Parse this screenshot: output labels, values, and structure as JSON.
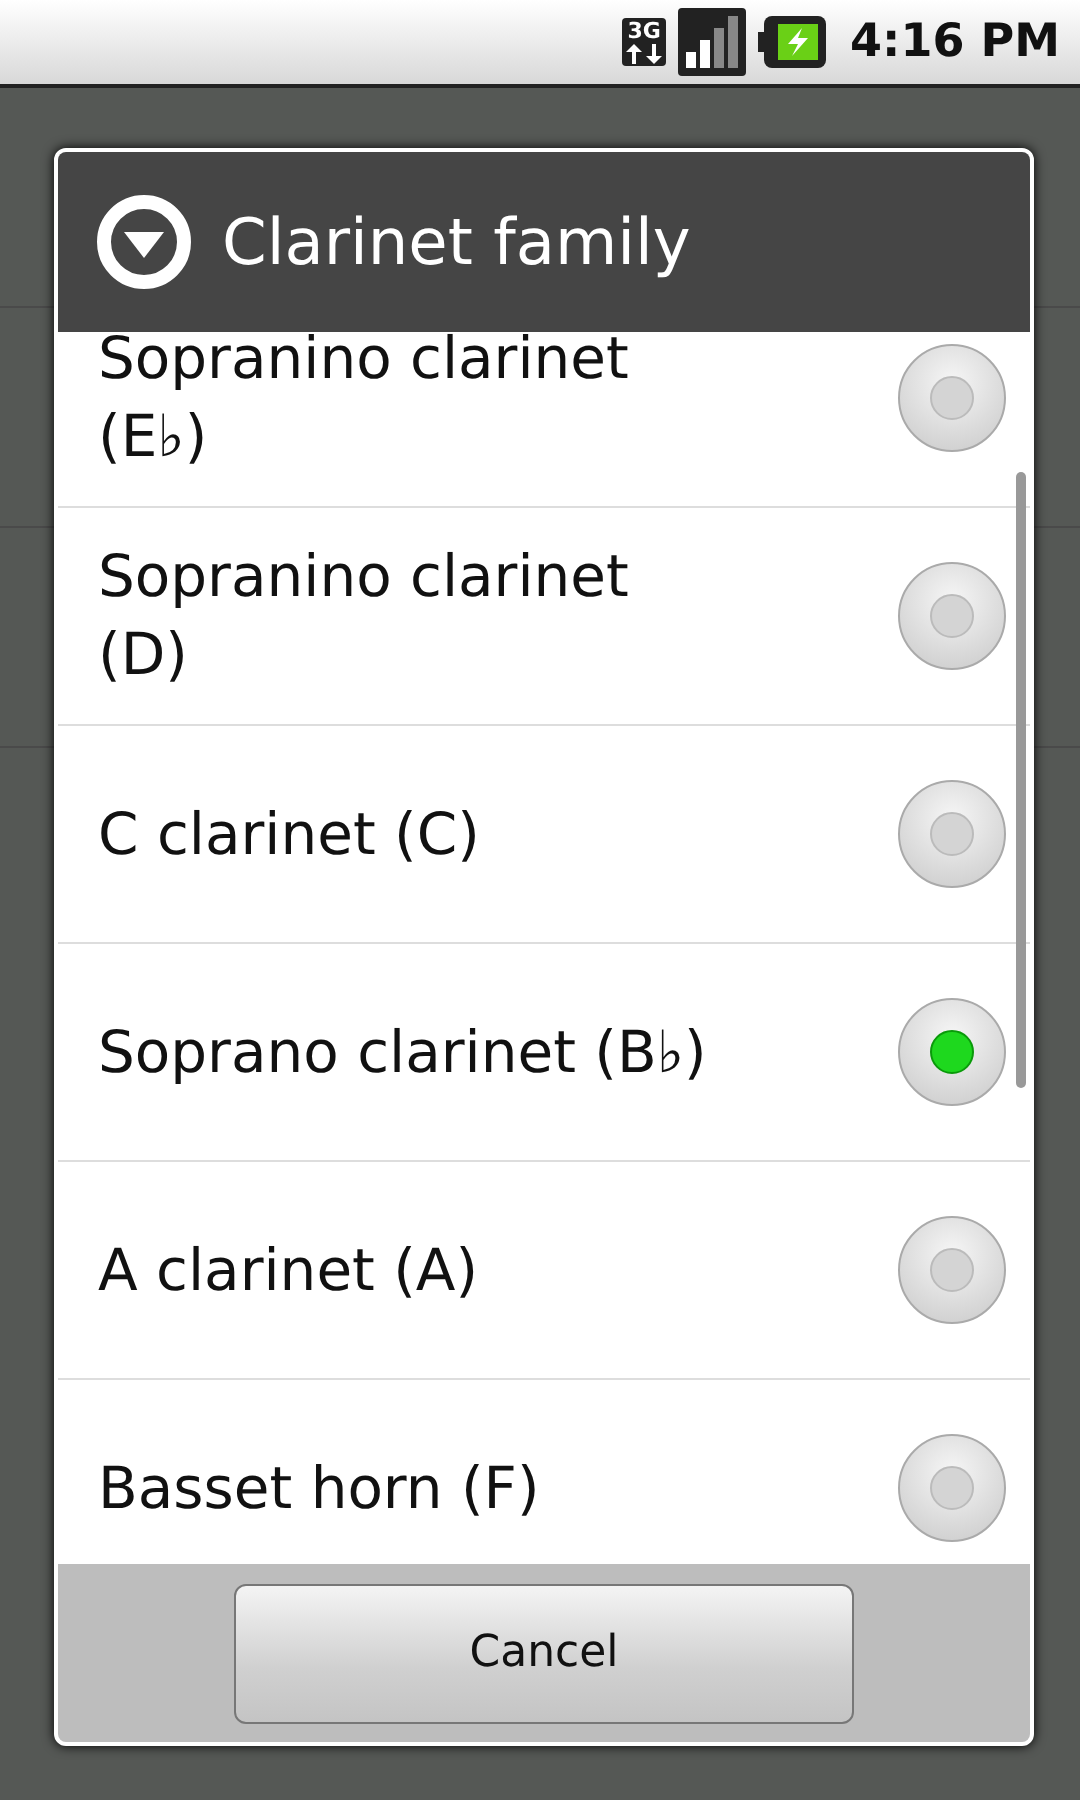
{
  "status_bar": {
    "network": "3G",
    "time": "4:16 PM"
  },
  "dialog": {
    "title": "Clarinet family",
    "options": [
      {
        "label": "Sopranino clarinet (E♭)",
        "selected": false
      },
      {
        "label": "Sopranino clarinet (D)",
        "selected": false
      },
      {
        "label": "C clarinet (C)",
        "selected": false
      },
      {
        "label": "Soprano clarinet (B♭)",
        "selected": true
      },
      {
        "label": "A clarinet (A)",
        "selected": false
      },
      {
        "label": "Basset horn (F)",
        "selected": false
      }
    ],
    "buttons": [
      "Cancel"
    ]
  }
}
